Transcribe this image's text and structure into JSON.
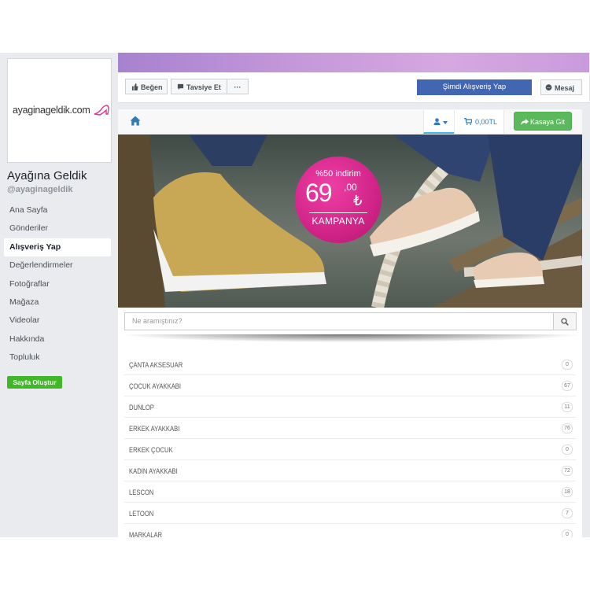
{
  "sidebar": {
    "logo_text": "ayaginageldik.com",
    "page_name": "Ayağına Geldik",
    "handle": "@ayaginageldik",
    "items": [
      {
        "label": "Ana Sayfa"
      },
      {
        "label": "Gönderiler"
      },
      {
        "label": "Alışveriş Yap"
      },
      {
        "label": "Değerlendirmeler"
      },
      {
        "label": "Fotoğraflar"
      },
      {
        "label": "Mağaza"
      },
      {
        "label": "Videolar"
      },
      {
        "label": "Hakkında"
      },
      {
        "label": "Topluluk"
      }
    ],
    "create_button": "Sayfa Oluştur"
  },
  "actions": {
    "like": "Beğen",
    "recommend": "Tavsiye Et",
    "more": "···",
    "shop_now": "Şimdi Alışveriş Yap",
    "message": "Mesaj"
  },
  "shop": {
    "cart_total": "0,00TL",
    "checkout": "Kasaya Git",
    "search_placeholder": "Ne aramıştınız?"
  },
  "banner": {
    "discount": "%50 indirim",
    "price_main": "69",
    "price_decimal": ",00",
    "currency": "₺",
    "campaign": "KAMPANYA"
  },
  "categories": [
    {
      "name": "ÇANTA AKSESUAR",
      "count": "0"
    },
    {
      "name": "ÇOCUK AYAKKABI",
      "count": "67"
    },
    {
      "name": "DUNLOP",
      "count": "11"
    },
    {
      "name": "ERKEK AYAKKABI",
      "count": "76"
    },
    {
      "name": "ERKEK ÇOCUK",
      "count": "0"
    },
    {
      "name": "KADIN AYAKKABI",
      "count": "72"
    },
    {
      "name": "LESCON",
      "count": "18"
    },
    {
      "name": "LETOON",
      "count": "7"
    },
    {
      "name": "MARKALAR",
      "count": "0"
    }
  ],
  "colors": {
    "fb_blue": "#4267b2",
    "accent_green": "#5cb85c",
    "promo_pink": "#d12488"
  }
}
